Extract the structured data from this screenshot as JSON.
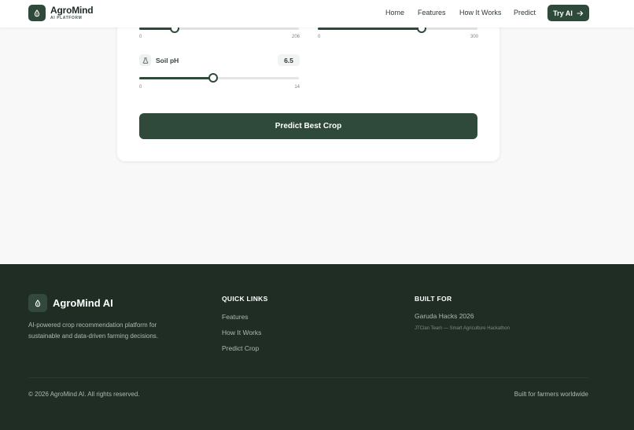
{
  "header": {
    "brand_name": "AgroMind",
    "brand_sub": "AI PLATFORM",
    "logo_icon": "leaf-drop-icon",
    "nav": [
      "Home",
      "Features",
      "How It Works",
      "Predict"
    ],
    "cta_label": "Try AI",
    "cta_icon": "arrow-right-icon"
  },
  "form": {
    "slider_left": {
      "min": "0",
      "max": "206",
      "fraction": 0.22
    },
    "slider_right": {
      "min": "0",
      "max": "300",
      "fraction": 0.65
    },
    "soil_ph": {
      "label": "Soil pH",
      "icon": "flask-icon",
      "value": "6.5",
      "min": "0",
      "max": "14",
      "fraction": 0.464
    },
    "submit_label": "Predict Best Crop"
  },
  "footer": {
    "brand_name": "AgroMind AI",
    "logo_icon": "leaf-drop-icon",
    "description": "AI-powered crop recommendation platform for sustainable and data-driven farming decisions.",
    "quick_links_heading": "QUICK LINKS",
    "quick_links": [
      "Features",
      "How It Works",
      "Predict Crop"
    ],
    "built_for_heading": "BUILT FOR",
    "built_for_event": "Garuda Hacks 2026",
    "built_for_team": "JTClan Team — Smart Agriculture Hackathon",
    "copyright": "© 2026 AgroMind AI. All rights reserved.",
    "tagline": "Built for farmers worldwide"
  },
  "colors": {
    "primary": "#2f4a3a",
    "footer_bg": "#1f2d25",
    "page_bg": "#f7f8f7"
  }
}
